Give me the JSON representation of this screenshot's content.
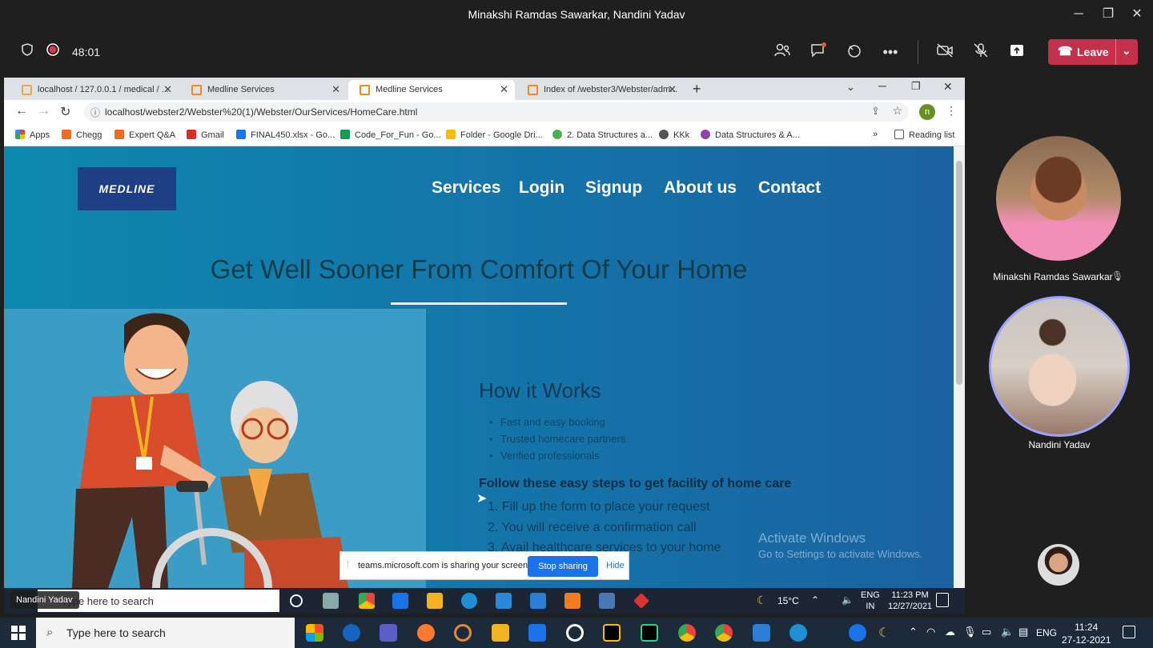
{
  "teams": {
    "window_title": "Minakshi Ramdas Sawarkar, Nandini Yadav",
    "timer": "48:01",
    "leave_label": "Leave"
  },
  "browser": {
    "tabs": [
      {
        "label": "localhost / 127.0.0.1 / medical / ..."
      },
      {
        "label": "Medline Services"
      },
      {
        "label": "Medline Services"
      },
      {
        "label": "Index of /webster3/Webster/adm..."
      }
    ],
    "url": "localhost/webster2/Webster%20(1)/Webster/OurServices/HomeCare.html",
    "profile_initial": "n",
    "bookmarks": [
      {
        "label": "Apps",
        "color": "#e8453c"
      },
      {
        "label": "Chegg",
        "color": "#f26a21"
      },
      {
        "label": "Expert Q&A",
        "color": "#f26a21"
      },
      {
        "label": "Gmail",
        "color": "#d93025"
      },
      {
        "label": "FINAL450.xlsx - Go...",
        "color": "#1a73e8"
      },
      {
        "label": "Code_For_Fun - Go...",
        "color": "#0f9d58"
      },
      {
        "label": "Folder - Google Dri...",
        "color": "#fbbc04"
      },
      {
        "label": "2. Data Structures a...",
        "color": "#4caf50"
      },
      {
        "label": "KKk",
        "color": "#555555"
      },
      {
        "label": "Data Structures & A...",
        "color": "#8e44ad"
      }
    ],
    "bookmarks_overflow": "»",
    "reading_list": "Reading list"
  },
  "page": {
    "logo_text": "MEDLINE",
    "nav": [
      "Services",
      "Login",
      "Signup",
      "About us",
      "Contact"
    ],
    "headline": "Get Well Sooner From Comfort Of Your Home",
    "how_title": "How it Works",
    "how_items": [
      "Fast and easy booking",
      "Trusted homecare partners",
      "Verified professionals"
    ],
    "steps_title": "Follow these easy steps to get facility of home care",
    "steps": [
      "1. Fill up the form to place your request",
      "2. You will receive a confirmation call",
      "3. Avail healthcare services to your home"
    ],
    "activate_line1": "Activate Windows",
    "activate_line2": "Go to Settings to activate Windows."
  },
  "share_bar": {
    "message": "teams.microsoft.com is sharing your screen.",
    "stop_label": "Stop sharing",
    "hide_label": "Hide"
  },
  "inner_taskbar": {
    "search_placeholder": "Type here to search",
    "presenter_name": "Nandini Yadav",
    "temperature": "15°C",
    "lang_line1": "ENG",
    "lang_line2": "IN",
    "time": "11:23 PM",
    "date": "12/27/2021"
  },
  "participants": [
    {
      "name": "Minakshi Ramdas Sawarkar",
      "muted_icon": "mic-off-icon"
    },
    {
      "name": "Nandini Yadav"
    }
  ],
  "taskbar": {
    "search_placeholder": "Type here to search",
    "lang": "ENG",
    "time": "11:24",
    "date": "27-12-2021"
  }
}
